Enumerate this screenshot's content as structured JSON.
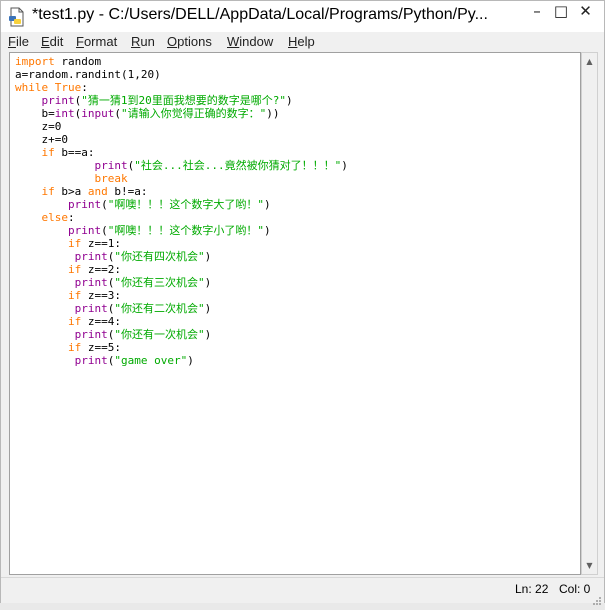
{
  "window": {
    "title": "*test1.py - C:/Users/DELL/AppData/Local/Programs/Python/Py...",
    "minimize_glyph": "–",
    "maximize_glyph": "□",
    "close_glyph": "✕"
  },
  "menu": [
    {
      "first": "F",
      "rest": "ile"
    },
    {
      "first": "E",
      "rest": "dit"
    },
    {
      "first": "F",
      "rest": "ormat"
    },
    {
      "first": "R",
      "rest": "un"
    },
    {
      "first": "O",
      "rest": "ptions"
    },
    {
      "first": "W",
      "rest": "indow"
    },
    {
      "first": "H",
      "rest": "elp"
    }
  ],
  "code_lines": [
    [
      [
        "kw",
        "import"
      ],
      [
        "n",
        " random"
      ]
    ],
    [
      [
        "n",
        "a=random.randint(1,20)"
      ]
    ],
    [
      [
        "kw",
        "while"
      ],
      [
        "n",
        " "
      ],
      [
        "kw",
        "True"
      ],
      [
        "n",
        ":"
      ]
    ],
    [
      [
        "n",
        "    "
      ],
      [
        "bi",
        "print"
      ],
      [
        "n",
        "("
      ],
      [
        "str",
        "\"猜一猜1到20里面我想要的数字是哪个?\""
      ],
      [
        "n",
        ")"
      ]
    ],
    [
      [
        "n",
        "    b="
      ],
      [
        "bi",
        "int"
      ],
      [
        "n",
        "("
      ],
      [
        "bi",
        "input"
      ],
      [
        "n",
        "("
      ],
      [
        "str",
        "\"请输入你觉得正确的数字：\""
      ],
      [
        "n",
        "))"
      ]
    ],
    [
      [
        "n",
        "    z=0"
      ]
    ],
    [
      [
        "n",
        "    z+=0"
      ]
    ],
    [
      [
        "n",
        "    "
      ],
      [
        "kw",
        "if"
      ],
      [
        "n",
        " b==a:"
      ]
    ],
    [
      [
        "n",
        "            "
      ],
      [
        "bi",
        "print"
      ],
      [
        "n",
        "("
      ],
      [
        "str",
        "\"社会...社会...竟然被你猜对了！！！\""
      ],
      [
        "n",
        ")"
      ]
    ],
    [
      [
        "n",
        "            "
      ],
      [
        "kw",
        "break"
      ]
    ],
    [
      [
        "n",
        "    "
      ],
      [
        "kw",
        "if"
      ],
      [
        "n",
        " b>a "
      ],
      [
        "kw",
        "and"
      ],
      [
        "n",
        " b!=a:"
      ]
    ],
    [
      [
        "n",
        "        "
      ],
      [
        "bi",
        "print"
      ],
      [
        "n",
        "("
      ],
      [
        "str",
        "\"啊噢！！！这个数字大了哟！\""
      ],
      [
        "n",
        ")"
      ]
    ],
    [
      [
        "n",
        "    "
      ],
      [
        "kw",
        "else"
      ],
      [
        "n",
        ":"
      ]
    ],
    [
      [
        "n",
        "        "
      ],
      [
        "bi",
        "print"
      ],
      [
        "n",
        "("
      ],
      [
        "str",
        "\"啊噢！！！这个数字小了哟！\""
      ],
      [
        "n",
        ")"
      ]
    ],
    [
      [
        "n",
        "        "
      ],
      [
        "kw",
        "if"
      ],
      [
        "n",
        " z==1:"
      ]
    ],
    [
      [
        "n",
        "         "
      ],
      [
        "bi",
        "print"
      ],
      [
        "n",
        "("
      ],
      [
        "str",
        "\"你还有四次机会\""
      ],
      [
        "n",
        ")"
      ]
    ],
    [
      [
        "n",
        "        "
      ],
      [
        "kw",
        "if"
      ],
      [
        "n",
        " z==2:"
      ]
    ],
    [
      [
        "n",
        "         "
      ],
      [
        "bi",
        "print"
      ],
      [
        "n",
        "("
      ],
      [
        "str",
        "\"你还有三次机会\""
      ],
      [
        "n",
        ")"
      ]
    ],
    [
      [
        "n",
        "        "
      ],
      [
        "kw",
        "if"
      ],
      [
        "n",
        " z==3:"
      ]
    ],
    [
      [
        "n",
        "         "
      ],
      [
        "bi",
        "print"
      ],
      [
        "n",
        "("
      ],
      [
        "str",
        "\"你还有二次机会\""
      ],
      [
        "n",
        ")"
      ]
    ],
    [
      [
        "n",
        "        "
      ],
      [
        "kw",
        "if"
      ],
      [
        "n",
        " z==4:"
      ]
    ],
    [
      [
        "n",
        "         "
      ],
      [
        "bi",
        "print"
      ],
      [
        "n",
        "("
      ],
      [
        "str",
        "\"你还有一次机会\""
      ],
      [
        "n",
        ")"
      ]
    ],
    [
      [
        "n",
        "        "
      ],
      [
        "kw",
        "if"
      ],
      [
        "n",
        " z==5:"
      ]
    ],
    [
      [
        "n",
        "         "
      ],
      [
        "bi",
        "print"
      ],
      [
        "n",
        "("
      ],
      [
        "str",
        "\"game over\""
      ],
      [
        "n",
        ")"
      ]
    ]
  ],
  "status": {
    "line": "Ln: 22",
    "col": "Col: 0"
  },
  "colors": {
    "keyword": "#ff7700",
    "builtin": "#900090",
    "string": "#00aa00"
  },
  "scroll": {
    "up_glyph": "▲",
    "down_glyph": "▼"
  }
}
